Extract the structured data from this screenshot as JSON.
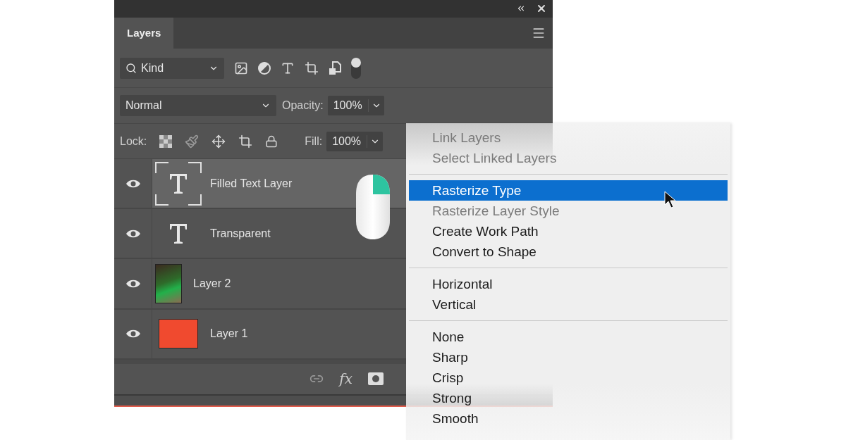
{
  "panel": {
    "tab": {
      "label": "Layers",
      "selected": true
    },
    "filter": {
      "value": "Kind"
    },
    "blend_mode": {
      "value": "Normal"
    },
    "opacity": {
      "label": "Opacity:",
      "value": "100%"
    },
    "lock": {
      "label": "Lock:"
    },
    "fill": {
      "label": "Fill:",
      "value": "100%"
    },
    "layers": [
      {
        "name": "Filled Text Layer",
        "kind": "text",
        "selected": true,
        "visible": true
      },
      {
        "name": "Transparent",
        "kind": "text",
        "selected": false,
        "visible": true
      },
      {
        "name": "Layer 2",
        "kind": "photo",
        "selected": false,
        "visible": true
      },
      {
        "name": "Layer 1",
        "kind": "fill",
        "selected": false,
        "visible": true
      }
    ],
    "footer": {
      "effects": "fx"
    }
  },
  "context_menu": {
    "groups": [
      [
        {
          "label": "Link Layers",
          "disabled": true,
          "selected": false
        },
        {
          "label": "Select Linked Layers",
          "disabled": true,
          "selected": false
        }
      ],
      [
        {
          "label": "Rasterize Type",
          "disabled": false,
          "selected": true
        },
        {
          "label": "Rasterize Layer Style",
          "disabled": true,
          "selected": false
        },
        {
          "label": "Create Work Path",
          "disabled": false,
          "selected": false
        },
        {
          "label": "Convert to Shape",
          "disabled": false,
          "selected": false
        }
      ],
      [
        {
          "label": "Horizontal",
          "disabled": false,
          "selected": false
        },
        {
          "label": "Vertical",
          "disabled": false,
          "selected": false
        }
      ],
      [
        {
          "label": "None",
          "disabled": false,
          "selected": false
        },
        {
          "label": "Sharp",
          "disabled": false,
          "selected": false
        },
        {
          "label": "Crisp",
          "disabled": false,
          "selected": false
        },
        {
          "label": "Strong",
          "disabled": false,
          "selected": false
        },
        {
          "label": "Smooth",
          "disabled": false,
          "selected": false
        }
      ]
    ]
  }
}
